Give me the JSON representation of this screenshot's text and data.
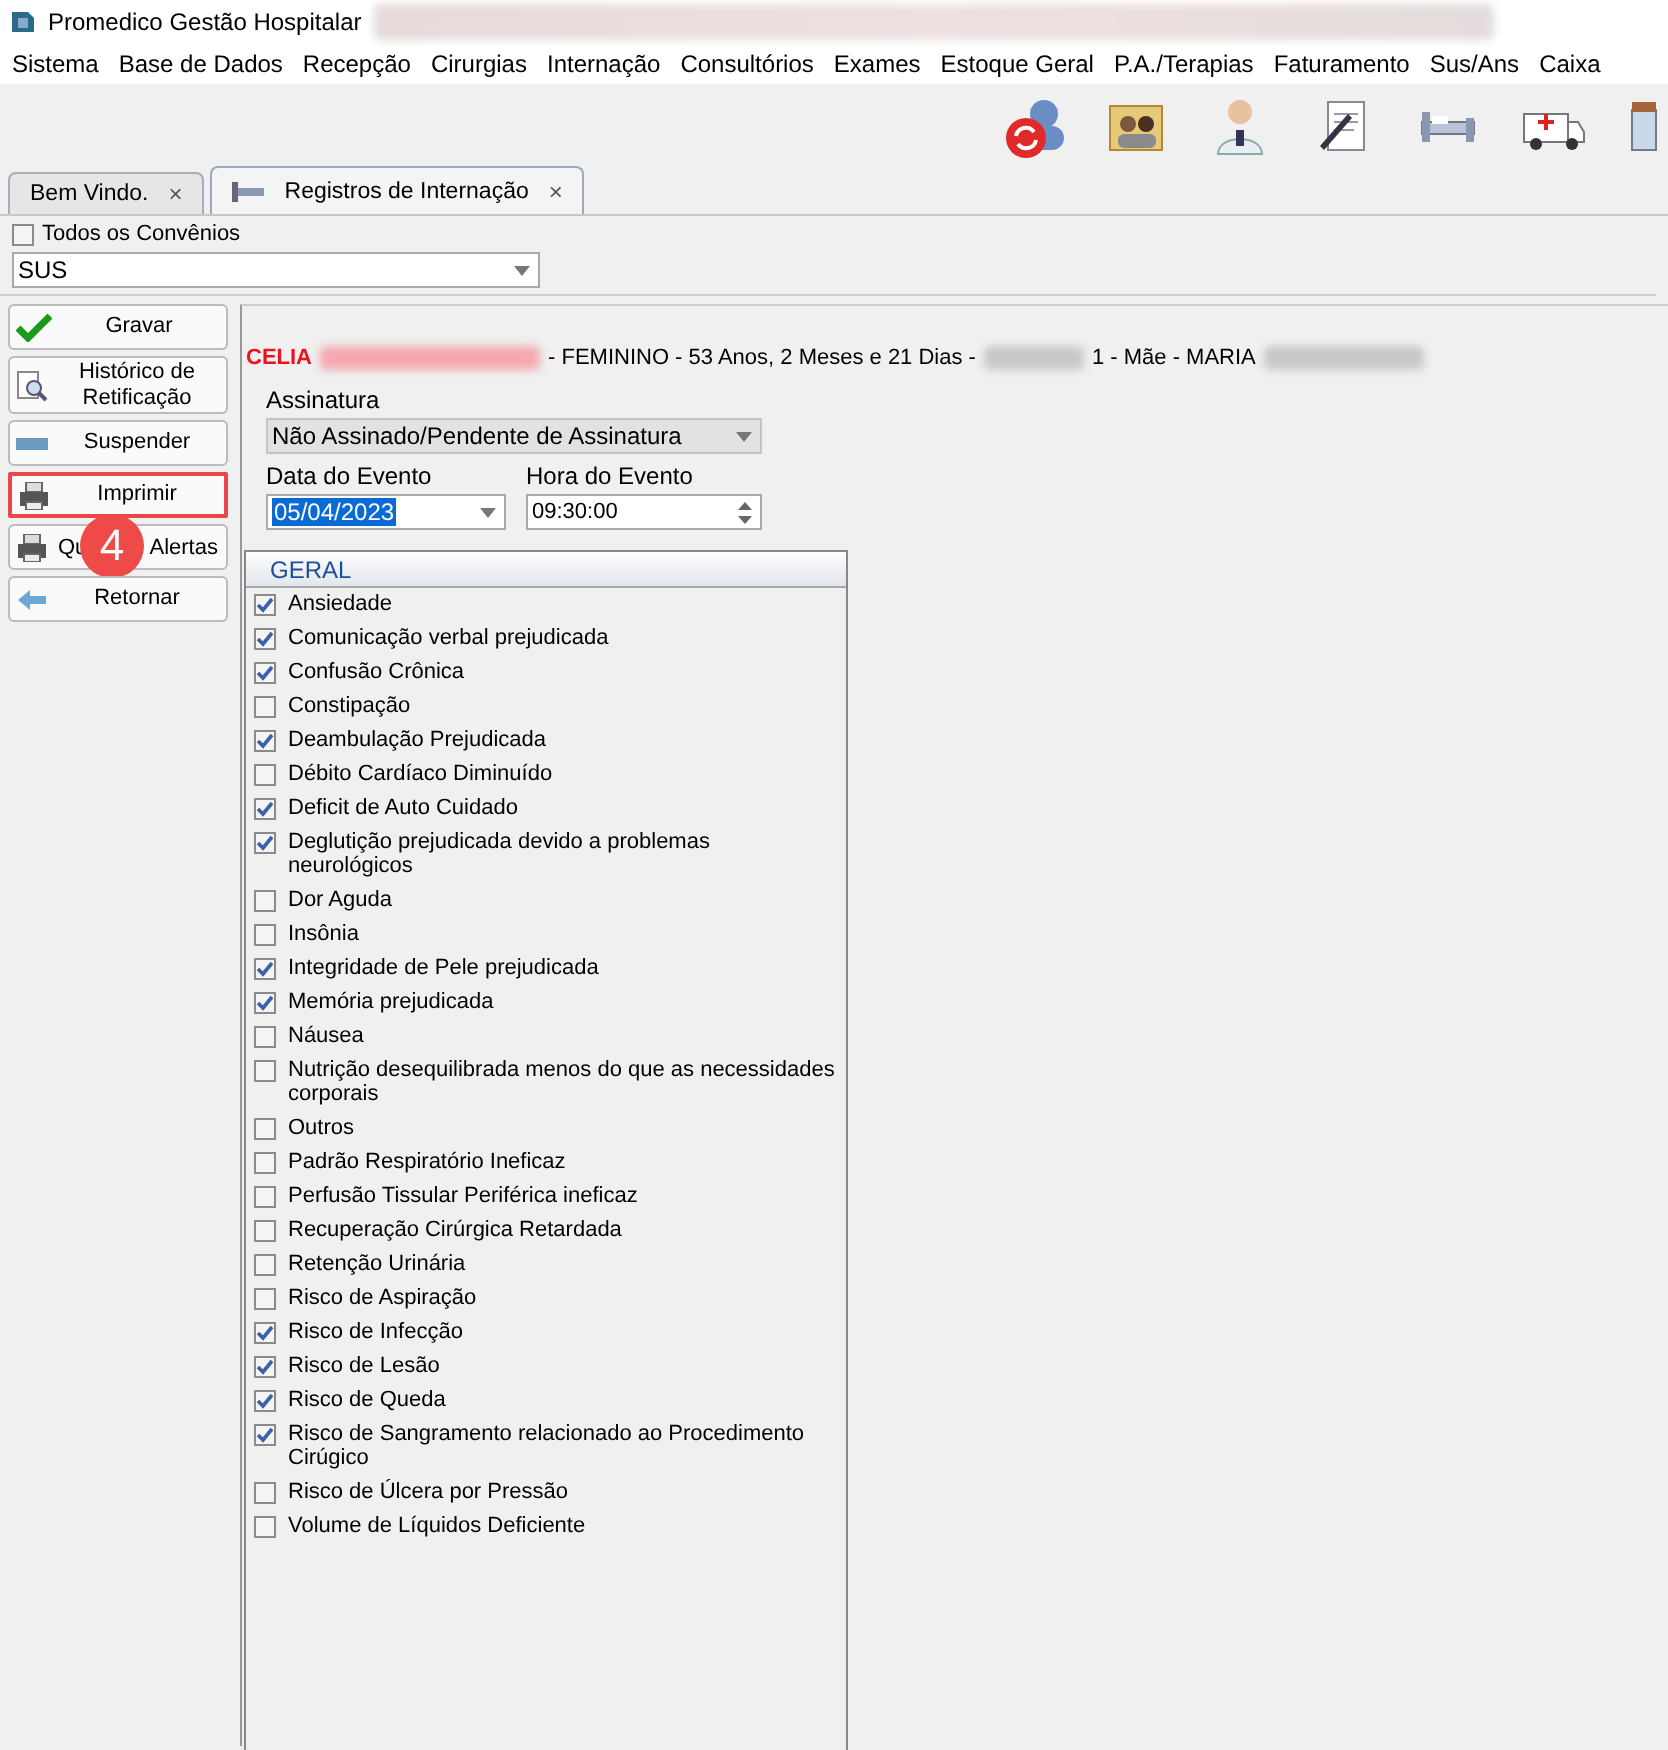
{
  "window": {
    "title": "Promedico Gestão Hospitalar"
  },
  "menu": [
    {
      "label": "Sistema"
    },
    {
      "label": "Base de Dados"
    },
    {
      "label": "Recepção"
    },
    {
      "label": "Cirurgias"
    },
    {
      "label": "Internação"
    },
    {
      "label": "Consultórios"
    },
    {
      "label": "Exames"
    },
    {
      "label": "Estoque Geral"
    },
    {
      "label": "P.A./Terapias"
    },
    {
      "label": "Faturamento"
    },
    {
      "label": "Sus/Ans"
    },
    {
      "label": "Caixa"
    }
  ],
  "tabs": [
    {
      "label": "Bem Vindo.",
      "selected": false,
      "close": "×"
    },
    {
      "label": "Registros de Internação",
      "selected": true,
      "close": "×"
    }
  ],
  "filter": {
    "all_insurers": {
      "label": "Todos os Convênios",
      "checked": false
    },
    "insurer": {
      "value": "SUS"
    }
  },
  "actions": [
    {
      "kind": "save",
      "label": "Gravar",
      "highlighted": false
    },
    {
      "kind": "history",
      "label": "Histórico de Retificação",
      "highlighted": false
    },
    {
      "kind": "suspend",
      "label": "Suspender",
      "highlighted": false
    },
    {
      "kind": "print",
      "label": "Imprimir",
      "highlighted": true
    },
    {
      "kind": "alerts",
      "label_parts": [
        "Qu",
        "Alertas"
      ],
      "highlighted": false
    },
    {
      "kind": "back",
      "label": "Retornar",
      "highlighted": false
    }
  ],
  "callout": {
    "number": "4"
  },
  "patient": {
    "name": "CELIA",
    "details": "- FEMININO - 53 Anos, 2 Meses e 21 Dias -",
    "details_2": "1 - Mãe - MARIA"
  },
  "form": {
    "signature": {
      "label": "Assinatura",
      "value": "Não Assinado/Pendente de Assinatura",
      "disabled": true
    },
    "event_date": {
      "label": "Data do Evento",
      "value": "05/04/2023",
      "selected": true
    },
    "event_time": {
      "label": "Hora do Evento",
      "value": "09:30:00"
    }
  },
  "checklist": {
    "header": "GERAL",
    "items": [
      {
        "label": "Ansiedade",
        "checked": true
      },
      {
        "label": "Comunicação verbal prejudicada",
        "checked": true
      },
      {
        "label": "Confusão Crônica",
        "checked": true
      },
      {
        "label": "Constipação",
        "checked": false
      },
      {
        "label": "Deambulação Prejudicada",
        "checked": true
      },
      {
        "label": "Débito Cardíaco Diminuído",
        "checked": false
      },
      {
        "label": "Deficit de Auto Cuidado",
        "checked": true
      },
      {
        "label": "Deglutição prejudicada devido a problemas neurológicos",
        "checked": true
      },
      {
        "label": "Dor Aguda",
        "checked": false
      },
      {
        "label": "Insônia",
        "checked": false
      },
      {
        "label": "Integridade de Pele prejudicada",
        "checked": true
      },
      {
        "label": "Memória prejudicada",
        "checked": true
      },
      {
        "label": "Náusea",
        "checked": false
      },
      {
        "label": "Nutrição desequilibrada menos do que as necessidades corporais",
        "checked": false
      },
      {
        "label": "Outros",
        "checked": false
      },
      {
        "label": "Padrão Respiratório Ineficaz",
        "checked": false
      },
      {
        "label": "Perfusão Tissular Periférica ineficaz",
        "checked": false
      },
      {
        "label": "Recuperação Cirúrgica Retardada",
        "checked": false
      },
      {
        "label": "Retenção Urinária",
        "checked": false
      },
      {
        "label": "Risco de Aspiração",
        "checked": false
      },
      {
        "label": "Risco de Infecção",
        "checked": true
      },
      {
        "label": "Risco de Lesão",
        "checked": true
      },
      {
        "label": "Risco de Queda",
        "checked": true
      },
      {
        "label": "Risco de Sangramento relacionado ao Procedimento Cirúgico",
        "checked": true
      },
      {
        "label": "Risco de Úlcera por Pressão",
        "checked": false
      },
      {
        "label": "Volume de Líquidos Deficiente",
        "checked": false
      }
    ]
  }
}
